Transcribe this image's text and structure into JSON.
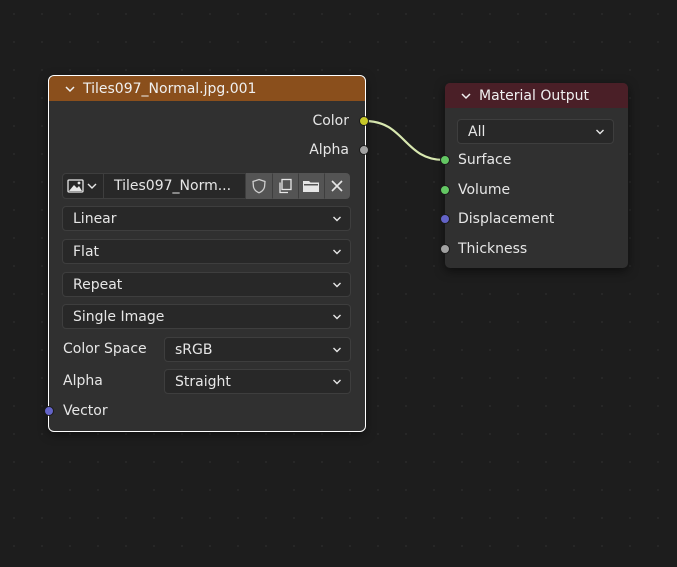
{
  "image_node": {
    "title": "Tiles097_Normal.jpg.001",
    "header_color": "#8a4f1c",
    "outputs": [
      "Color",
      "Alpha"
    ],
    "image_name": "Tiles097_Norm...",
    "interpolation": "Linear",
    "projection": "Flat",
    "extension": "Repeat",
    "source": "Single Image",
    "color_space_label": "Color Space",
    "color_space_value": "sRGB",
    "alpha_label": "Alpha",
    "alpha_value": "Straight",
    "input": "Vector"
  },
  "output_node": {
    "title": "Material Output",
    "header_color": "#4a1f27",
    "target": "All",
    "inputs": [
      "Surface",
      "Volume",
      "Displacement",
      "Thickness"
    ]
  },
  "colors": {
    "color_socket": "#c7c729",
    "float_socket": "#a1a1a1",
    "shader_socket": "#63c763",
    "vector_socket": "#6363c7",
    "link": "#d8e8b0"
  }
}
